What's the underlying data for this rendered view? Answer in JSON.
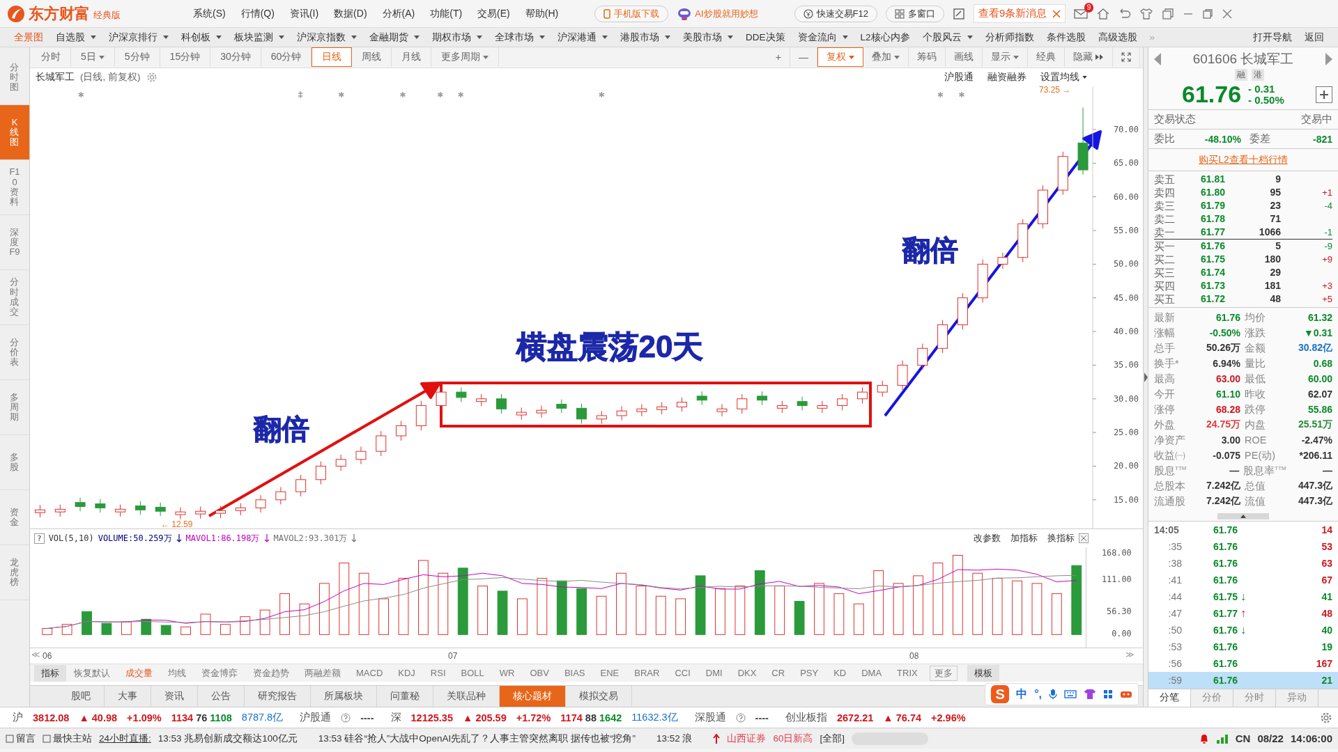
{
  "title_bar": {
    "brand": "东方财富",
    "edition": "经典版",
    "menus": [
      "系统(S)",
      "行情(Q)",
      "资讯(I)",
      "数据(D)",
      "分析(A)",
      "功能(T)",
      "交易(E)",
      "帮助(H)"
    ],
    "phone_button": "手机版下载",
    "ai_promo": "AI炒股就用妙想",
    "quick_trade": "快速交易F12",
    "multi_window": "多窗口",
    "messages": "查看9条新消息",
    "mail_badge": "9"
  },
  "nav": {
    "items": [
      {
        "label": "全景图",
        "selected": true,
        "dropdown": false
      },
      {
        "label": "自选股",
        "selected": false,
        "dropdown": true
      },
      {
        "label": "沪深京排行",
        "selected": false,
        "dropdown": true
      },
      {
        "label": "科创板",
        "selected": false,
        "dropdown": true
      },
      {
        "label": "板块监测",
        "selected": false,
        "dropdown": true
      },
      {
        "label": "沪深京指数",
        "selected": false,
        "dropdown": true
      },
      {
        "label": "金融期货",
        "selected": false,
        "dropdown": true
      },
      {
        "label": "期权市场",
        "selected": false,
        "dropdown": true
      },
      {
        "label": "全球市场",
        "selected": false,
        "dropdown": true
      },
      {
        "label": "沪深港通",
        "selected": false,
        "dropdown": true
      },
      {
        "label": "港股市场",
        "selected": false,
        "dropdown": true
      },
      {
        "label": "美股市场",
        "selected": false,
        "dropdown": true
      },
      {
        "label": "DDE决策",
        "selected": false,
        "dropdown": false
      },
      {
        "label": "资金流向",
        "selected": false,
        "dropdown": true
      },
      {
        "label": "L2核心内参",
        "selected": false,
        "dropdown": false
      },
      {
        "label": "个股风云",
        "selected": false,
        "dropdown": true
      },
      {
        "label": "分析师指数",
        "selected": false,
        "dropdown": false
      },
      {
        "label": "条件选股",
        "selected": false,
        "dropdown": false
      },
      {
        "label": "高级选股",
        "selected": false,
        "dropdown": false
      }
    ],
    "more": "»",
    "right": [
      "打开导航",
      "返回"
    ]
  },
  "side_tabs": [
    {
      "label": "分时图",
      "selected": false
    },
    {
      "label": "K线图",
      "selected": true
    },
    {
      "label": "F10资料",
      "selected": false
    },
    {
      "label": "深度F9",
      "selected": false
    },
    {
      "label": "分时成交",
      "selected": false
    },
    {
      "label": "分价表",
      "selected": false
    },
    {
      "label": "多周期",
      "selected": false
    },
    {
      "label": "多股",
      "selected": false
    },
    {
      "label": "资金",
      "selected": false
    },
    {
      "label": "龙虎榜",
      "selected": false
    }
  ],
  "periods": [
    {
      "label": "分时",
      "selected": false,
      "dropdown": false
    },
    {
      "label": "5日",
      "selected": false,
      "dropdown": true
    },
    {
      "label": "5分钟",
      "selected": false,
      "dropdown": false
    },
    {
      "label": "15分钟",
      "selected": false,
      "dropdown": false
    },
    {
      "label": "30分钟",
      "selected": false,
      "dropdown": false
    },
    {
      "label": "60分钟",
      "selected": false,
      "dropdown": false
    },
    {
      "label": "日线",
      "selected": true,
      "dropdown": false
    },
    {
      "label": "周线",
      "selected": false,
      "dropdown": false
    },
    {
      "label": "月线",
      "selected": false,
      "dropdown": false
    },
    {
      "label": "更多周期",
      "selected": false,
      "dropdown": true
    }
  ],
  "chart_tools": [
    {
      "label": "+",
      "selected": false,
      "dropdown": false
    },
    {
      "label": "—",
      "selected": false,
      "dropdown": false
    },
    {
      "label": "复权",
      "selected": true,
      "dropdown": true
    },
    {
      "label": "叠加",
      "selected": false,
      "dropdown": true
    },
    {
      "label": "筹码",
      "selected": false,
      "dropdown": false
    },
    {
      "label": "画线",
      "selected": false,
      "dropdown": false
    },
    {
      "label": "显示",
      "selected": false,
      "dropdown": true
    },
    {
      "label": "经典",
      "selected": false,
      "dropdown": false
    },
    {
      "label": "隐藏",
      "selected": false,
      "dropdown": false
    }
  ],
  "chart": {
    "title": "长城军工",
    "subtitle": "(日线, 前复权)",
    "links": [
      {
        "label": "沪股通",
        "dropdown": false
      },
      {
        "label": "融资融券",
        "dropdown": false
      },
      {
        "label": "设置均线",
        "dropdown": true
      }
    ],
    "chart_data": {
      "type": "candlestick",
      "categories": [
        null,
        null,
        null,
        null,
        null,
        null,
        null,
        null,
        null,
        null,
        null,
        null,
        null,
        null,
        null,
        null,
        null,
        null,
        null,
        null,
        null,
        null,
        null,
        null,
        null,
        null,
        null,
        null,
        null,
        null,
        null,
        null,
        null,
        null,
        null,
        null,
        null,
        null,
        null,
        null,
        null,
        null,
        null,
        null,
        null,
        null,
        null,
        null,
        null,
        null,
        null,
        null,
        null
      ],
      "ylim": [
        10.74,
        76.31
      ],
      "yticks": [
        {
          "value": 70,
          "label": "70.00"
        },
        {
          "value": 65,
          "label": "65.00"
        },
        {
          "value": 60,
          "label": "60.00"
        },
        {
          "value": 55,
          "label": "55.00"
        },
        {
          "value": 50,
          "label": "50.00"
        },
        {
          "value": 45,
          "label": "45.00"
        },
        {
          "value": 40,
          "label": "40.00"
        },
        {
          "value": 35,
          "label": "35.00"
        },
        {
          "value": 30,
          "label": "30.00"
        },
        {
          "value": 25,
          "label": "25.00"
        },
        {
          "value": 20,
          "label": "20.00"
        },
        {
          "value": 15,
          "label": "15.00"
        }
      ],
      "ohlc": [
        [
          13.1,
          14.2,
          12.4,
          13.5
        ],
        [
          13.2,
          14.3,
          12.5,
          13.6
        ],
        [
          14.6,
          15.3,
          13.3,
          14.0
        ],
        [
          14.4,
          15.1,
          13.1,
          13.8
        ],
        [
          13.2,
          14.3,
          12.5,
          13.6
        ],
        [
          14.1,
          14.8,
          12.8,
          13.5
        ],
        [
          13.9,
          14.6,
          12.6,
          13.3
        ],
        [
          12.8,
          13.9,
          12.1,
          13.2
        ],
        [
          12.9,
          14.0,
          12.2,
          13.3
        ],
        [
          13.0,
          14.1,
          12.3,
          13.4
        ],
        [
          13.4,
          14.5,
          12.7,
          13.8
        ],
        [
          13.8,
          15.7,
          13.1,
          15.0
        ],
        [
          15.0,
          16.9,
          14.3,
          16.2
        ],
        [
          16.2,
          18.7,
          15.5,
          18.0
        ],
        [
          18.0,
          20.7,
          17.3,
          20.0
        ],
        [
          20.0,
          21.7,
          19.3,
          21.0
        ],
        [
          21.0,
          22.9,
          20.3,
          22.2
        ],
        [
          22.2,
          25.2,
          21.5,
          24.5
        ],
        [
          24.5,
          26.7,
          23.8,
          26.0
        ],
        [
          26.0,
          29.7,
          25.3,
          29.0
        ],
        [
          29.0,
          31.7,
          28.3,
          31.0
        ],
        [
          31.0,
          31.7,
          29.5,
          30.2
        ],
        [
          29.6,
          30.7,
          28.9,
          30.0
        ],
        [
          30.0,
          30.7,
          27.8,
          28.5
        ],
        [
          27.6,
          28.7,
          26.9,
          28.0
        ],
        [
          27.9,
          29.0,
          27.2,
          28.3
        ],
        [
          29.2,
          29.9,
          27.9,
          28.6
        ],
        [
          28.6,
          29.3,
          26.3,
          27.0
        ],
        [
          27.0,
          28.2,
          26.3,
          27.5
        ],
        [
          27.5,
          28.9,
          26.8,
          28.2
        ],
        [
          28.1,
          29.2,
          27.4,
          28.5
        ],
        [
          28.4,
          29.5,
          27.7,
          28.8
        ],
        [
          28.8,
          30.2,
          28.1,
          29.5
        ],
        [
          30.4,
          31.1,
          29.1,
          29.8
        ],
        [
          28.1,
          29.2,
          27.4,
          28.5
        ],
        [
          28.5,
          30.7,
          27.8,
          30.0
        ],
        [
          30.4,
          31.1,
          29.1,
          29.8
        ],
        [
          28.6,
          29.7,
          27.9,
          29.0
        ],
        [
          29.6,
          30.3,
          28.3,
          29.0
        ],
        [
          28.6,
          29.7,
          27.9,
          29.0
        ],
        [
          29.0,
          30.7,
          28.3,
          30.0
        ],
        [
          30.0,
          31.7,
          29.3,
          31.0
        ],
        [
          31.0,
          32.7,
          30.3,
          32.0
        ],
        [
          32.0,
          35.7,
          31.3,
          35.0
        ],
        [
          35.0,
          38.2,
          34.3,
          37.5
        ],
        [
          37.5,
          41.7,
          36.8,
          41.0
        ],
        [
          41.0,
          45.7,
          40.3,
          45.0
        ],
        [
          45.0,
          50.7,
          44.3,
          50.0
        ],
        [
          50.0,
          51.7,
          49.3,
          51.0
        ],
        [
          51.0,
          56.7,
          50.3,
          56.0
        ],
        [
          56.0,
          61.7,
          55.3,
          61.0
        ],
        [
          61.0,
          66.7,
          60.3,
          66.0
        ],
        [
          68.0,
          73.25,
          63.3,
          64.0
        ]
      ]
    },
    "high_label": "73.25 →",
    "low_label": "← 12.59",
    "annotations": [
      {
        "text": "翻倍"
      },
      {
        "text": "横盘震荡20天"
      },
      {
        "text": "翻倍"
      }
    ]
  },
  "volume": {
    "help": "?",
    "indicator": "VOL(5,10)",
    "values": [
      {
        "text": "VOLUME:50.259万",
        "color": "#000080"
      },
      {
        "text": "MAVOL1:86.198万",
        "color": "#c000c0"
      },
      {
        "text": "MAVOL2:93.301万",
        "color": "#707070"
      }
    ],
    "actions": [
      "改参数",
      "加指标",
      "换指标"
    ],
    "yticks": [
      "168.00",
      "111.00",
      "56.30",
      "0.00"
    ]
  },
  "x_axis": [
    "06",
    "07",
    "08"
  ],
  "x_axis_nav": [
    "≪",
    "≫"
  ],
  "indicator_tabs": [
    {
      "label": "指标",
      "kind": "header",
      "selected": false
    },
    {
      "label": "恢复默认",
      "kind": "tab",
      "selected": false
    },
    {
      "label": "成交量",
      "kind": "tab",
      "selected": true
    },
    {
      "label": "均线",
      "kind": "tab",
      "selected": false
    },
    {
      "label": "资金博弈",
      "kind": "tab",
      "selected": false
    },
    {
      "label": "资金趋势",
      "kind": "tab",
      "selected": false
    },
    {
      "label": "两融差额",
      "kind": "tab",
      "selected": false
    },
    {
      "label": "MACD",
      "kind": "tab",
      "selected": false
    },
    {
      "label": "KDJ",
      "kind": "tab",
      "selected": false
    },
    {
      "label": "RSI",
      "kind": "tab",
      "selected": false
    },
    {
      "label": "BOLL",
      "kind": "tab",
      "selected": false
    },
    {
      "label": "WR",
      "kind": "tab",
      "selected": false
    },
    {
      "label": "OBV",
      "kind": "tab",
      "selected": false
    },
    {
      "label": "BIAS",
      "kind": "tab",
      "selected": false
    },
    {
      "label": "ENE",
      "kind": "tab",
      "selected": false
    },
    {
      "label": "BRAR",
      "kind": "tab",
      "selected": false
    },
    {
      "label": "CCI",
      "kind": "tab",
      "selected": false
    },
    {
      "label": "DMI",
      "kind": "tab",
      "selected": false
    },
    {
      "label": "DKX",
      "kind": "tab",
      "selected": false
    },
    {
      "label": "CR",
      "kind": "tab",
      "selected": false
    },
    {
      "label": "PSY",
      "kind": "tab",
      "selected": false
    },
    {
      "label": "KD",
      "kind": "tab",
      "selected": false
    },
    {
      "label": "DMA",
      "kind": "tab",
      "selected": false
    },
    {
      "label": "TRIX",
      "kind": "tab",
      "selected": false
    },
    {
      "label": "更多",
      "kind": "more",
      "selected": false
    },
    {
      "label": "模板",
      "kind": "template",
      "selected": false
    }
  ],
  "bottom_tabs": [
    {
      "label": "股吧",
      "selected": false
    },
    {
      "label": "大事",
      "selected": false
    },
    {
      "label": "资讯",
      "selected": false
    },
    {
      "label": "公告",
      "selected": false
    },
    {
      "label": "研究报告",
      "selected": false
    },
    {
      "label": "所属板块",
      "selected": false
    },
    {
      "label": "问董秘",
      "selected": false
    },
    {
      "label": "关联品种",
      "selected": false
    },
    {
      "label": "核心题材",
      "selected": true
    },
    {
      "label": "模拟交易",
      "selected": false
    }
  ],
  "ime": {
    "logo": "S",
    "mode": "中",
    "punct": "°,"
  },
  "quote": {
    "code": "601606",
    "name": "长城军工",
    "tags": [
      "融",
      "港"
    ],
    "price": "61.76",
    "change": "- 0.31",
    "pct": "- 0.50%",
    "status_label": "交易状态",
    "status": "交易中",
    "weibi_label": "委比",
    "weibi": "-48.10%",
    "weicha_label": "委差",
    "weicha": "-821",
    "l2_link": "购买L2查看十档行情",
    "sells": [
      {
        "label": "卖五",
        "price": "61.81",
        "vol": "9"
      },
      {
        "label": "卖四",
        "price": "61.80",
        "vol": "95",
        "delta": "+1",
        "color": "#d0161b"
      },
      {
        "label": "卖三",
        "price": "61.79",
        "vol": "23",
        "delta": "-4",
        "color": "#0a8a2a"
      },
      {
        "label": "卖二",
        "price": "61.78",
        "vol": "71"
      },
      {
        "label": "卖一",
        "price": "61.77",
        "vol": "1066",
        "delta": "-1",
        "color": "#0a8a2a"
      }
    ],
    "buys": [
      {
        "label": "买一",
        "price": "61.76",
        "vol": "5",
        "delta": "-9",
        "color": "#0a8a2a"
      },
      {
        "label": "买二",
        "price": "61.75",
        "vol": "180",
        "delta": "+9",
        "color": "#d0161b"
      },
      {
        "label": "买三",
        "price": "61.74",
        "vol": "29"
      },
      {
        "label": "买四",
        "price": "61.73",
        "vol": "181",
        "delta": "+3",
        "color": "#d0161b"
      },
      {
        "label": "买五",
        "price": "61.72",
        "vol": "48",
        "delta": "+5",
        "color": "#d0161b"
      }
    ],
    "stats": [
      [
        {
          "label": "最新",
          "value": "61.76",
          "color": "#0a8a2a"
        },
        {
          "label": "均价",
          "value": "61.32",
          "color": "#0a8a2a"
        }
      ],
      [
        {
          "label": "涨幅",
          "value": "-0.50%",
          "color": "#0a8a2a"
        },
        {
          "label": "涨跌",
          "value": "▼0.31",
          "color": "#0a8a2a"
        }
      ],
      [
        {
          "label": "总手",
          "value": "50.26万",
          "color": "#333333"
        },
        {
          "label": "金额",
          "value": "30.82亿",
          "color": "#1a70c8"
        }
      ],
      [
        {
          "label": "换手*",
          "value": "6.94%",
          "color": "#333333"
        },
        {
          "label": "量比",
          "value": "0.68",
          "color": "#0a8a2a"
        }
      ],
      [
        {
          "label": "最高",
          "value": "63.00",
          "color": "#d0161b"
        },
        {
          "label": "最低",
          "value": "60.00",
          "color": "#0a8a2a"
        }
      ],
      [
        {
          "label": "今开",
          "value": "61.10",
          "color": "#0a8a2a"
        },
        {
          "label": "昨收",
          "value": "62.07",
          "color": "#333333"
        }
      ],
      [
        {
          "label": "涨停",
          "value": "68.28",
          "color": "#d0161b"
        },
        {
          "label": "跌停",
          "value": "55.86",
          "color": "#0a8a2a"
        }
      ],
      [
        {
          "label": "外盘",
          "value": "24.75万",
          "color": "#e04040"
        },
        {
          "label": "内盘",
          "value": "25.51万",
          "color": "#2a8a3a"
        }
      ],
      [
        {
          "label": "净资产",
          "value": "3.00",
          "color": "#333333"
        },
        {
          "label": "ROE",
          "value": "-2.47%",
          "color": "#333333"
        }
      ],
      [
        {
          "label": "收益㈠",
          "value": "-0.075",
          "color": "#333333"
        },
        {
          "label": "PE(动)",
          "value": "*206.11",
          "color": "#333333"
        }
      ],
      [
        {
          "label": "股息$^{TTM}$",
          "value": "—",
          "color": "#333333"
        },
        {
          "label": "股息率$^{TTM}$",
          "value": "—",
          "color": "#333333"
        }
      ],
      [
        {
          "label": "总股本",
          "value": "7.242亿",
          "color": "#333333"
        },
        {
          "label": "总值",
          "value": "447.3亿",
          "color": "#333333"
        }
      ],
      [
        {
          "label": "流通股",
          "value": "7.242亿",
          "color": "#333333"
        },
        {
          "label": "流值",
          "value": "447.3亿",
          "color": "#333333"
        }
      ]
    ],
    "ticks": [
      {
        "time": "14:05",
        "price": "61.76",
        "vol": "14",
        "color": "#d0161b",
        "selected": false
      },
      {
        "time": ":35",
        "price": "61.76",
        "vol": "53",
        "color": "#d0161b",
        "selected": false
      },
      {
        "time": ":38",
        "price": "61.76",
        "vol": "63",
        "color": "#d0161b",
        "selected": false
      },
      {
        "time": ":41",
        "price": "61.76",
        "vol": "67",
        "color": "#d0161b",
        "selected": false
      },
      {
        "time": ":44",
        "price": "61.75",
        "kind": "down",
        "arrow": "↓",
        "vol": "41",
        "color": "#0a8a2a",
        "selected": false
      },
      {
        "time": ":47",
        "price": "61.77",
        "kind": "up",
        "arrow": "↑",
        "vol": "48",
        "color": "#d0161b",
        "selected": false
      },
      {
        "time": ":50",
        "price": "61.76",
        "kind": "down",
        "arrow": "↓",
        "vol": "40",
        "color": "#0a8a2a",
        "selected": false
      },
      {
        "time": ":53",
        "price": "61.76",
        "vol": "19",
        "color": "#0a8a2a",
        "selected": false
      },
      {
        "time": ":56",
        "price": "61.76",
        "vol": "167",
        "color": "#d0161b",
        "selected": false
      },
      {
        "time": ":59",
        "price": "61.76",
        "vol": "21",
        "color": "#0a8a2a",
        "selected": true
      }
    ],
    "tabs": [
      {
        "label": "分笔",
        "selected": true
      },
      {
        "label": "分价",
        "selected": false
      },
      {
        "label": "分时",
        "selected": false
      },
      {
        "label": "异动",
        "selected": false
      }
    ]
  },
  "index_bar": [
    {
      "kind": "index",
      "name": "沪",
      "value": "3812.08",
      "change": "▲ 40.98",
      "pct": "+1.09%",
      "up": "1134",
      "flat": "76",
      "down": "1108",
      "amount": "8787.8亿"
    },
    {
      "kind": "connect",
      "name": "沪股通",
      "value": "----"
    },
    {
      "kind": "index",
      "name": "深",
      "value": "12125.35",
      "change": "▲ 205.59",
      "pct": "+1.72%",
      "up": "1174",
      "flat": "88",
      "down": "1642",
      "amount": "11632.3亿"
    },
    {
      "kind": "connect",
      "name": "深股通",
      "value": "----"
    },
    {
      "kind": "index",
      "name": "创业板指",
      "value": "2672.21",
      "change": "▲ 76.74",
      "pct": "+2.96%"
    }
  ],
  "news_bar": {
    "buttons": [
      "留言",
      "最快主站"
    ],
    "live_label": "24小时直播:",
    "items": [
      {
        "time": "13:53",
        "text": "兆易创新成交额达100亿元"
      },
      {
        "time": "13:53",
        "text": "硅谷“抢人”大战中OpenAI先乱了？人事主管突然离职 据传也被“挖角”"
      },
      {
        "time": "13:52",
        "text": "浪"
      }
    ],
    "alert_broker": "山西证券",
    "alert_text": "60日新高",
    "alert_all": "[全部]",
    "region": "CN",
    "date": "08/22",
    "time": "14:06:00"
  }
}
